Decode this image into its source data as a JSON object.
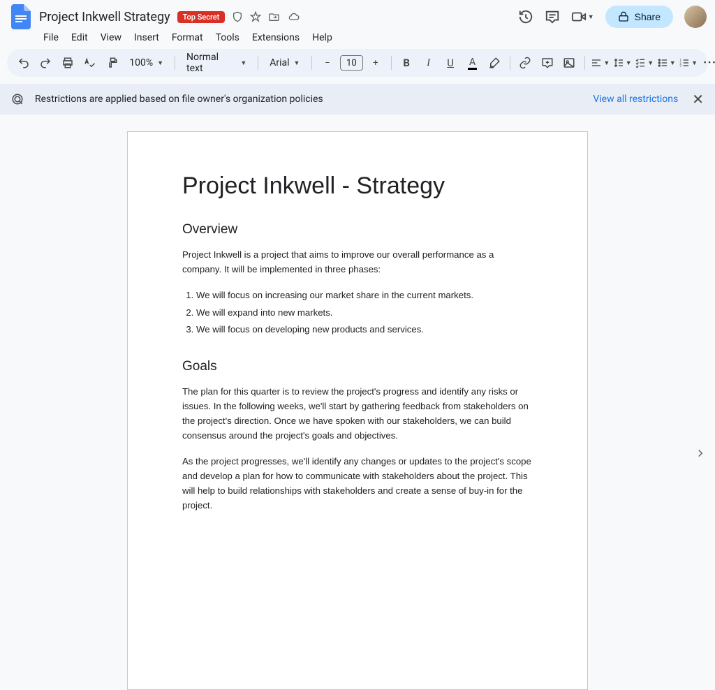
{
  "header": {
    "title": "Project Inkwell Strategy",
    "badge": "Top Secret",
    "share_label": "Share"
  },
  "menubar": [
    "File",
    "Edit",
    "View",
    "Insert",
    "Format",
    "Tools",
    "Extensions",
    "Help"
  ],
  "toolbar": {
    "zoom": "100%",
    "styles": "Normal text",
    "font": "Arial",
    "font_size": "10"
  },
  "banner": {
    "text": "Restrictions are applied based on file owner's organization policies",
    "link": "View all restrictions"
  },
  "document": {
    "title": "Project Inkwell - Strategy",
    "overview_heading": "Overview",
    "overview_para": "Project Inkwell is a project that aims to improve our overall performance as a company. It will be implemented in three phases:",
    "phases": [
      "We will focus on increasing our market share in the current markets.",
      "We will expand into new markets.",
      "We will focus on developing new products and services."
    ],
    "goals_heading": "Goals",
    "goals_p1": "The plan for this quarter is to review the project's progress and identify any risks or issues. In the following weeks, we'll start by gathering feedback from stakeholders on the project's direction. Once we have spoken with our stakeholders, we can build consensus around the project's goals and objectives.",
    "goals_p2": "As the project progresses, we'll identify any changes or updates to the project's scope and develop a plan for how to communicate with stakeholders about the project. This will help to build relationships with stakeholders and create a sense of buy-in for the project."
  }
}
